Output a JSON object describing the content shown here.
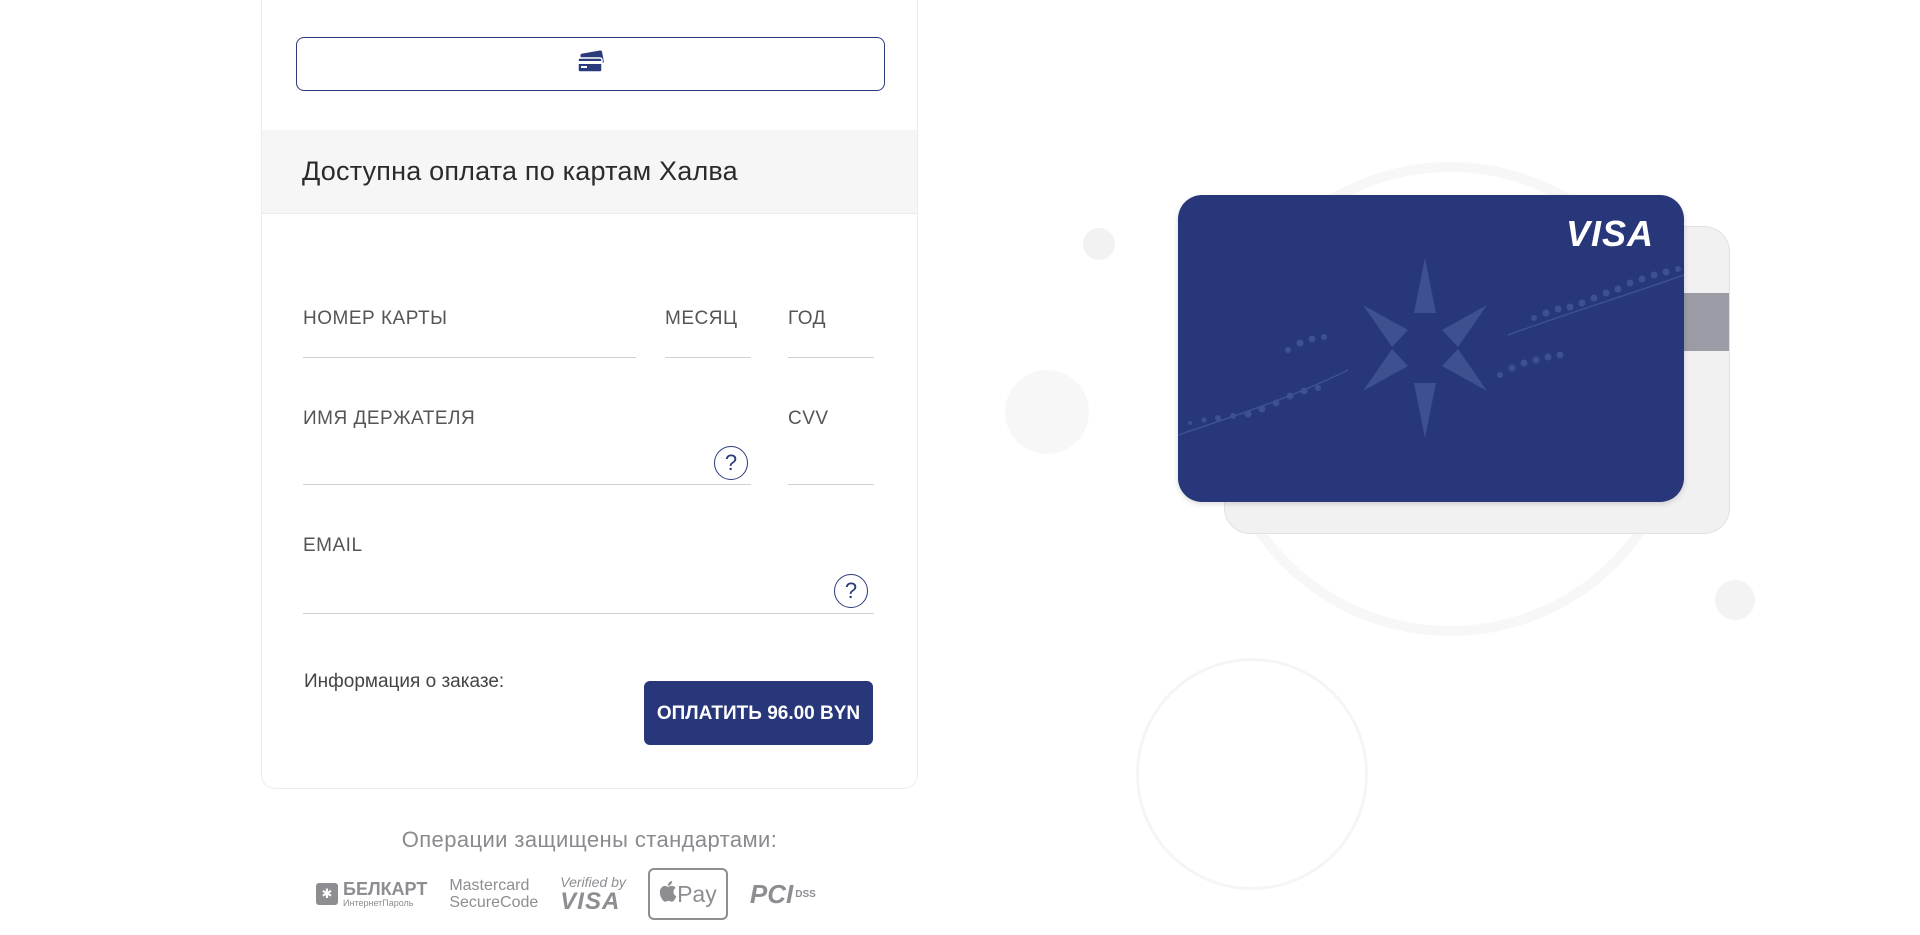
{
  "payment": {
    "halva_notice": "Доступна оплата по картам Халва",
    "fields": {
      "card_number_label": "НОМЕР КАРТЫ",
      "month_label": "МЕСЯЦ",
      "year_label": "ГОД",
      "holder_label": "ИМЯ ДЕРЖАТЕЛЯ",
      "cvv_label": "CVV",
      "email_label": "EMAIL",
      "help_glyph": "?"
    },
    "order_info_label": "Информация о заказе:",
    "pay_button_label": "ОПЛАТИТЬ 96.00 BYN"
  },
  "security": {
    "caption": "Операции защищены стандартами:",
    "logos": {
      "belkart_title": "БЕЛКАРТ",
      "belkart_sub": "ИнтернетПароль",
      "mastercard_line1": "Mastercard",
      "mastercard_line2": "SecureCode",
      "vbv_line1": "Verified by",
      "vbv_line2": "VISA",
      "applepay": "Pay",
      "pci": "PCI",
      "pci_dss": "DSS"
    }
  },
  "card_preview": {
    "brand": "VISA",
    "colors": {
      "card_front": "#28367a",
      "card_back": "#f1f1f2",
      "accent": "#28367a"
    }
  },
  "icons": {
    "card_method": "credit-card-icon",
    "help": "question-icon",
    "apple": "apple-icon"
  }
}
